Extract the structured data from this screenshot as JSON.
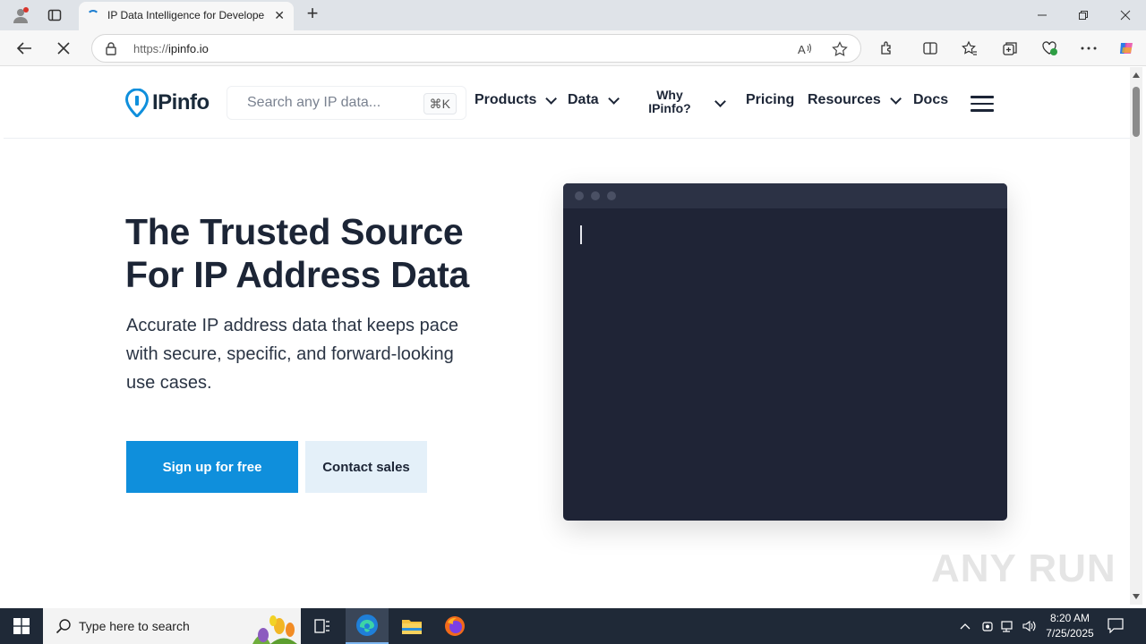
{
  "browser": {
    "tab_title": "IP Data Intelligence for Developers",
    "new_tab": "+",
    "url_protocol": "https://",
    "url_host": "ipinfo.io"
  },
  "site": {
    "logo_text": "IPinfo",
    "search": {
      "placeholder": "Search any IP data...",
      "shortcut": "⌘K"
    },
    "nav": {
      "products": "Products",
      "data": "Data",
      "why_line1": "Why",
      "why_line2": "IPinfo?",
      "pricing": "Pricing",
      "resources": "Resources",
      "docs": "Docs"
    },
    "hero": {
      "title": "The Trusted Source For IP Address Data",
      "subtitle": "Accurate IP address data that keeps pace with secure, specific, and forward-looking use cases.",
      "primary_cta": "Sign up for free",
      "secondary_cta": "Contact sales"
    },
    "accent_color": "#0f8fdc",
    "terminal_color": "#1f2436"
  },
  "watermark": "ANY RUN",
  "taskbar": {
    "search_placeholder": "Type here to search",
    "time": "8:20 AM",
    "date": "7/25/2025"
  }
}
